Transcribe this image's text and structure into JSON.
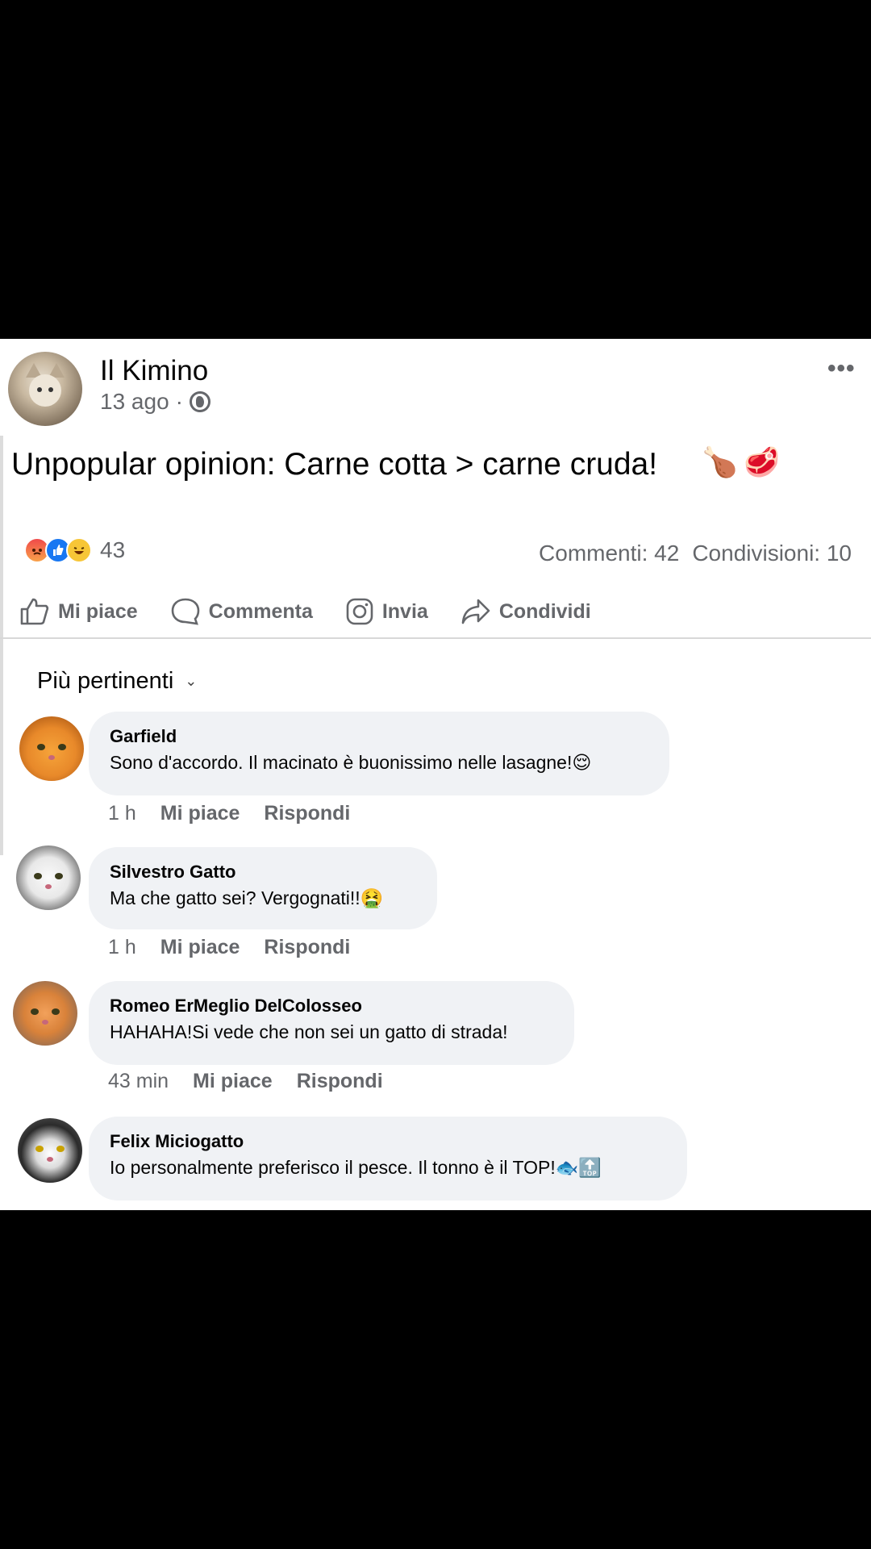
{
  "post": {
    "author": "Il Kimino",
    "time": "13 ago",
    "separator": "·",
    "menu_glyph": "•••",
    "text": "Unpopular opinion: Carne cotta > carne cruda!",
    "emoji_1": "🍗",
    "emoji_2": "🥩",
    "reactions_count": "43",
    "reaction_icons": [
      "angry-face-icon",
      "like-thumb-icon",
      "haha-face-icon"
    ],
    "comments_label": "Commenti: 42",
    "shares_label": "Condivisioni: 10"
  },
  "actions": {
    "like": "Mi piace",
    "comment": "Commenta",
    "send": "Invia",
    "share": "Condividi"
  },
  "sort": {
    "label": "Più pertinenti",
    "chevron": "⌄"
  },
  "comments": [
    {
      "name": "Garfield",
      "text": "Sono d'accordo. Il macinato è buonissimo nelle lasagne!😌",
      "time": "1 h",
      "like": "Mi piace",
      "reply": "Rispondi"
    },
    {
      "name": "Silvestro Gatto",
      "text": "Ma che gatto sei? Vergognati!!🤮",
      "time": "1 h",
      "like": "Mi piace",
      "reply": "Rispondi"
    },
    {
      "name": "Romeo ErMeglio DelColosseo",
      "text": "HAHAHA!Si vede che non sei un gatto di strada!",
      "time": "43 min",
      "like": "Mi piace",
      "reply": "Rispondi"
    },
    {
      "name": "Felix Miciogatto",
      "text": "Io personalmente preferisco il pesce. Il tonno è il TOP!🐟🔝",
      "time": "",
      "like": "",
      "reply": ""
    }
  ],
  "colors": {
    "text_primary": "#050505",
    "text_secondary": "#65676b",
    "bubble_bg": "#f0f2f5",
    "like_blue": "#1877f2"
  }
}
